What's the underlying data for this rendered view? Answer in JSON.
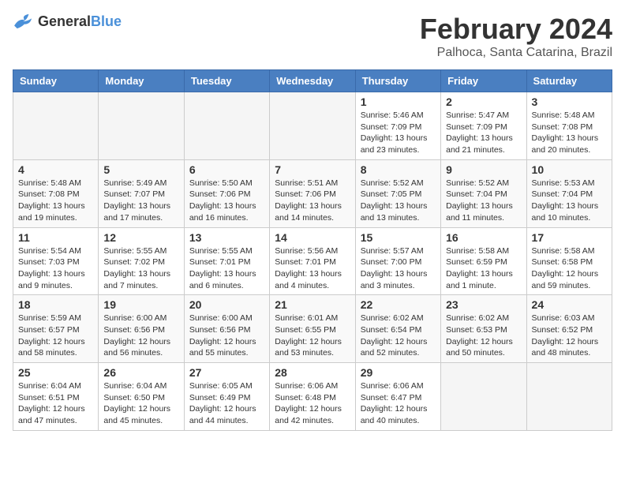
{
  "logo": {
    "general": "General",
    "blue": "Blue"
  },
  "header": {
    "month": "February 2024",
    "location": "Palhoca, Santa Catarina, Brazil"
  },
  "weekdays": [
    "Sunday",
    "Monday",
    "Tuesday",
    "Wednesday",
    "Thursday",
    "Friday",
    "Saturday"
  ],
  "weeks": [
    [
      {
        "day": "",
        "info": ""
      },
      {
        "day": "",
        "info": ""
      },
      {
        "day": "",
        "info": ""
      },
      {
        "day": "",
        "info": ""
      },
      {
        "day": "1",
        "info": "Sunrise: 5:46 AM\nSunset: 7:09 PM\nDaylight: 13 hours\nand 23 minutes."
      },
      {
        "day": "2",
        "info": "Sunrise: 5:47 AM\nSunset: 7:09 PM\nDaylight: 13 hours\nand 21 minutes."
      },
      {
        "day": "3",
        "info": "Sunrise: 5:48 AM\nSunset: 7:08 PM\nDaylight: 13 hours\nand 20 minutes."
      }
    ],
    [
      {
        "day": "4",
        "info": "Sunrise: 5:48 AM\nSunset: 7:08 PM\nDaylight: 13 hours\nand 19 minutes."
      },
      {
        "day": "5",
        "info": "Sunrise: 5:49 AM\nSunset: 7:07 PM\nDaylight: 13 hours\nand 17 minutes."
      },
      {
        "day": "6",
        "info": "Sunrise: 5:50 AM\nSunset: 7:06 PM\nDaylight: 13 hours\nand 16 minutes."
      },
      {
        "day": "7",
        "info": "Sunrise: 5:51 AM\nSunset: 7:06 PM\nDaylight: 13 hours\nand 14 minutes."
      },
      {
        "day": "8",
        "info": "Sunrise: 5:52 AM\nSunset: 7:05 PM\nDaylight: 13 hours\nand 13 minutes."
      },
      {
        "day": "9",
        "info": "Sunrise: 5:52 AM\nSunset: 7:04 PM\nDaylight: 13 hours\nand 11 minutes."
      },
      {
        "day": "10",
        "info": "Sunrise: 5:53 AM\nSunset: 7:04 PM\nDaylight: 13 hours\nand 10 minutes."
      }
    ],
    [
      {
        "day": "11",
        "info": "Sunrise: 5:54 AM\nSunset: 7:03 PM\nDaylight: 13 hours\nand 9 minutes."
      },
      {
        "day": "12",
        "info": "Sunrise: 5:55 AM\nSunset: 7:02 PM\nDaylight: 13 hours\nand 7 minutes."
      },
      {
        "day": "13",
        "info": "Sunrise: 5:55 AM\nSunset: 7:01 PM\nDaylight: 13 hours\nand 6 minutes."
      },
      {
        "day": "14",
        "info": "Sunrise: 5:56 AM\nSunset: 7:01 PM\nDaylight: 13 hours\nand 4 minutes."
      },
      {
        "day": "15",
        "info": "Sunrise: 5:57 AM\nSunset: 7:00 PM\nDaylight: 13 hours\nand 3 minutes."
      },
      {
        "day": "16",
        "info": "Sunrise: 5:58 AM\nSunset: 6:59 PM\nDaylight: 13 hours\nand 1 minute."
      },
      {
        "day": "17",
        "info": "Sunrise: 5:58 AM\nSunset: 6:58 PM\nDaylight: 12 hours\nand 59 minutes."
      }
    ],
    [
      {
        "day": "18",
        "info": "Sunrise: 5:59 AM\nSunset: 6:57 PM\nDaylight: 12 hours\nand 58 minutes."
      },
      {
        "day": "19",
        "info": "Sunrise: 6:00 AM\nSunset: 6:56 PM\nDaylight: 12 hours\nand 56 minutes."
      },
      {
        "day": "20",
        "info": "Sunrise: 6:00 AM\nSunset: 6:56 PM\nDaylight: 12 hours\nand 55 minutes."
      },
      {
        "day": "21",
        "info": "Sunrise: 6:01 AM\nSunset: 6:55 PM\nDaylight: 12 hours\nand 53 minutes."
      },
      {
        "day": "22",
        "info": "Sunrise: 6:02 AM\nSunset: 6:54 PM\nDaylight: 12 hours\nand 52 minutes."
      },
      {
        "day": "23",
        "info": "Sunrise: 6:02 AM\nSunset: 6:53 PM\nDaylight: 12 hours\nand 50 minutes."
      },
      {
        "day": "24",
        "info": "Sunrise: 6:03 AM\nSunset: 6:52 PM\nDaylight: 12 hours\nand 48 minutes."
      }
    ],
    [
      {
        "day": "25",
        "info": "Sunrise: 6:04 AM\nSunset: 6:51 PM\nDaylight: 12 hours\nand 47 minutes."
      },
      {
        "day": "26",
        "info": "Sunrise: 6:04 AM\nSunset: 6:50 PM\nDaylight: 12 hours\nand 45 minutes."
      },
      {
        "day": "27",
        "info": "Sunrise: 6:05 AM\nSunset: 6:49 PM\nDaylight: 12 hours\nand 44 minutes."
      },
      {
        "day": "28",
        "info": "Sunrise: 6:06 AM\nSunset: 6:48 PM\nDaylight: 12 hours\nand 42 minutes."
      },
      {
        "day": "29",
        "info": "Sunrise: 6:06 AM\nSunset: 6:47 PM\nDaylight: 12 hours\nand 40 minutes."
      },
      {
        "day": "",
        "info": ""
      },
      {
        "day": "",
        "info": ""
      }
    ]
  ]
}
